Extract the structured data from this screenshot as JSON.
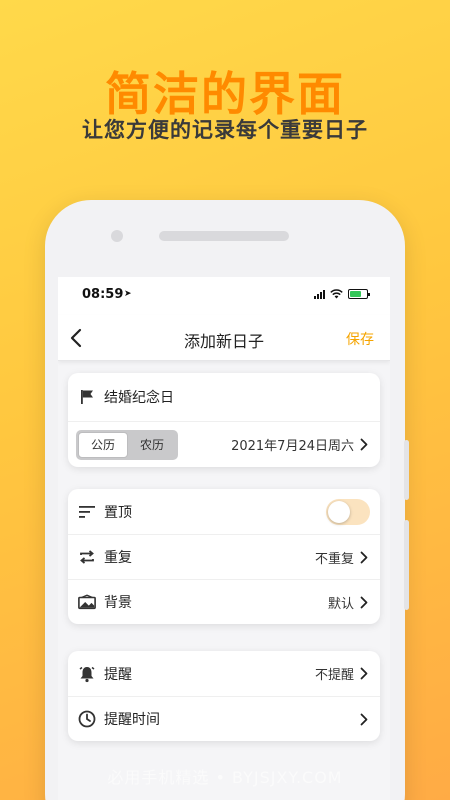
{
  "promo": {
    "title": "简洁的界面",
    "subtitle": "让您方便的记录每个重要日子"
  },
  "status_bar": {
    "time": "08:59",
    "location_arrow": "location-arrow-icon",
    "battery_charging": true
  },
  "nav": {
    "back_icon": "chevron-left-icon",
    "title": "添加新日子",
    "save_label": "保存"
  },
  "event_card": {
    "name": "结婚纪念日",
    "calendar_options": [
      "公历",
      "农历"
    ],
    "selected_calendar": "公历",
    "date_value": "2021年7月24日周六"
  },
  "settings_card": {
    "pin_label": "置顶",
    "pin_enabled": false,
    "repeat_label": "重复",
    "repeat_value": "不重复",
    "background_label": "背景",
    "background_value": "默认"
  },
  "reminder_card": {
    "reminder_label": "提醒",
    "reminder_value": "不提醒",
    "reminder_time_label": "提醒时间"
  },
  "watermark": "必用手机精选 • BYJSJXY.COM",
  "colors": {
    "accent": "#f5a400",
    "promo_title": "#ff8a00",
    "background_start": "#ffd94a",
    "background_end": "#ffab45"
  }
}
